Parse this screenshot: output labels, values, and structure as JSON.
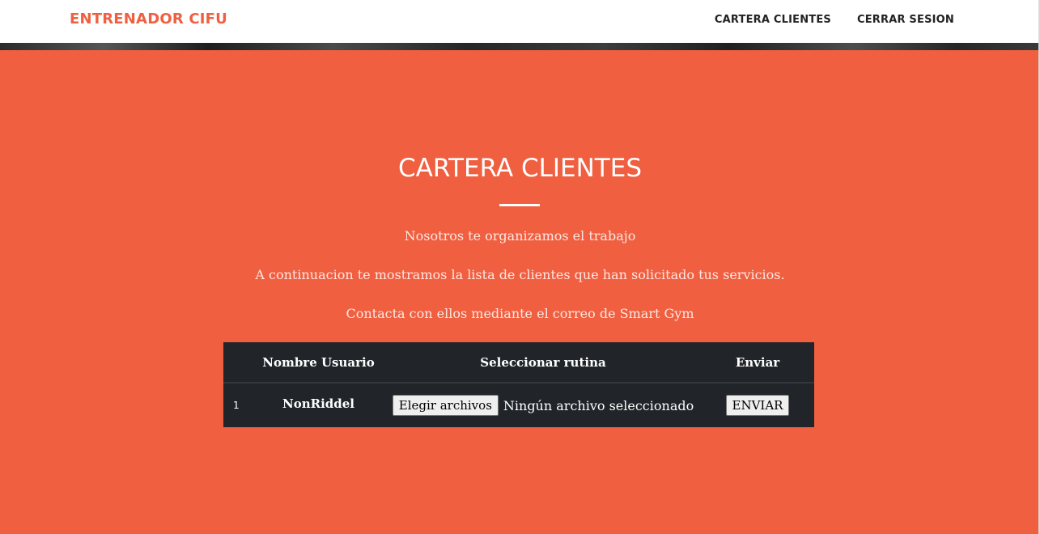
{
  "nav": {
    "brand": "ENTRENADOR CIFU",
    "links": [
      "CARTERA CLIENTES",
      "CERRAR SESION"
    ]
  },
  "section": {
    "title": "CARTERA CLIENTES",
    "paragraphs": [
      "Nosotros te organizamos el trabajo",
      "A continuacion te mostramos la lista de clientes que han solicitado tus servicios.",
      "Contacta con ellos mediante el correo de Smart Gym"
    ]
  },
  "table": {
    "headers": [
      "",
      "Nombre Usuario",
      "Seleccionar rutina",
      "Enviar"
    ],
    "rows": [
      {
        "index": "1",
        "user": "NonRiddel",
        "file_button": "Elegir archivos",
        "file_status": "Ningún archivo seleccionado",
        "send_button": "ENVIAR"
      }
    ]
  },
  "colors": {
    "accent": "#f05f40",
    "navbar": "#ffffff",
    "table_bg": "#212529"
  }
}
